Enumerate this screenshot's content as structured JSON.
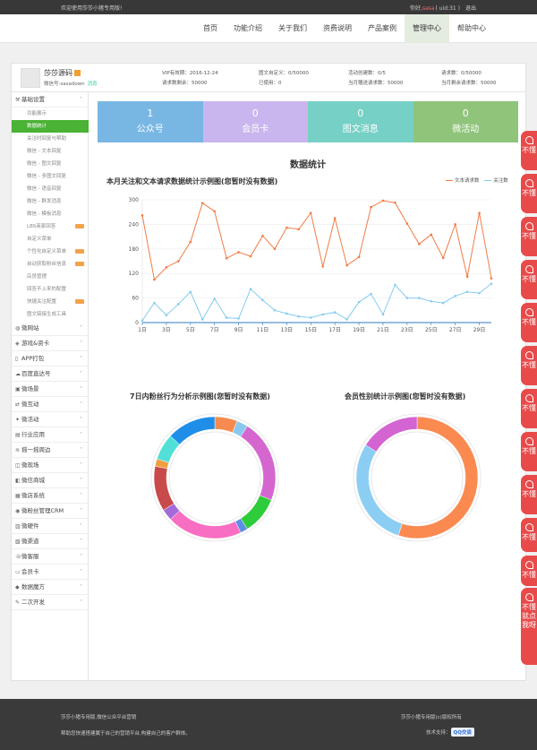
{
  "topbar": {
    "welcome": "欢迎使用莎莎小猪专用版!",
    "hello": "你好,",
    "user": "sasa",
    "uid": "( uid:31 )",
    "logout": "退出"
  },
  "nav": [
    "首页",
    "功能介绍",
    "关于我们",
    "资费说明",
    "产品案例",
    "管理中心",
    "帮助中心"
  ],
  "user": {
    "name": "莎莎源码",
    "account": "微信号:sasadown",
    "message": "消息"
  },
  "stats": {
    "vip": "VIP有效期：2016-12-24",
    "req_left": "请求数剩余：50000",
    "custom": "图文自定义：0/50000",
    "used": "已使用：0",
    "activity": "活动创建数：0/5",
    "month_req": "当月赠送请求数：50000",
    "req": "请求数：0/50000",
    "month_left": "当月剩余请求数：50000"
  },
  "sidebar": {
    "groups": [
      {
        "icon": "tools-icon",
        "label": "基础设置",
        "subs": [
          "功能展示",
          "数据统计",
          "关注时回复与帮助",
          "微信 - 文本回复",
          "微信 - 图文回复",
          "微信 - 多图文回复",
          "微信 - 语音回复",
          "微信 - 群发消息",
          "微信 - 模板消息",
          "LBS商家回答",
          "自定义菜单",
          "个性化自定义菜单",
          "自动获取粉丝信息",
          "店员管理",
          "回答不上来的配置",
          "快捷关注配置",
          "图文链接生成工具"
        ]
      },
      {
        "icon": "globe-icon",
        "label": "微网站"
      },
      {
        "icon": "gamepad-icon",
        "label": "游戏&资卡"
      },
      {
        "icon": "phone-icon",
        "label": "APP打包"
      },
      {
        "icon": "cloud-icon",
        "label": "百度直达号"
      },
      {
        "icon": "scene-icon",
        "label": "微场景"
      },
      {
        "icon": "interact-icon",
        "label": "微互动"
      },
      {
        "icon": "activity-icon",
        "label": "微活动"
      },
      {
        "icon": "industry-icon",
        "label": "行业应用"
      },
      {
        "icon": "shake-icon",
        "label": "摇一摇周边"
      },
      {
        "icon": "stage-icon",
        "label": "微现场"
      },
      {
        "icon": "shop-icon",
        "label": "微信商城"
      },
      {
        "icon": "system-icon",
        "label": "微店系统"
      },
      {
        "icon": "crm-icon",
        "label": "微粉丝管理CRM"
      },
      {
        "icon": "hardware-icon",
        "label": "微硬件"
      },
      {
        "icon": "channel-icon",
        "label": "微渠道"
      },
      {
        "icon": "service-icon",
        "label": "微客服"
      },
      {
        "icon": "card-icon",
        "label": "会员卡"
      },
      {
        "icon": "magic-icon",
        "label": "数据魔方"
      },
      {
        "icon": "wrench-icon",
        "label": "二次开发"
      }
    ],
    "active_sub": "数据统计",
    "hot_subs": [
      "LBS商家回答",
      "个性化自定义菜单",
      "自动获取粉丝信息",
      "快捷关注配置"
    ]
  },
  "tiles": [
    {
      "num": "1",
      "label": "公众号",
      "color": "#78b7e4"
    },
    {
      "num": "0",
      "label": "会员卡",
      "color": "#c9b6ee"
    },
    {
      "num": "0",
      "label": "图文消息",
      "color": "#76d0c5"
    },
    {
      "num": "0",
      "label": "微活动",
      "color": "#8fc47a"
    }
  ],
  "section_title": "数据统计",
  "chart_data": [
    {
      "type": "line",
      "title": "本月关注和文本请求数据统计示例图(您暂时没有数据)",
      "x": [
        "1日",
        "2日",
        "3日",
        "4日",
        "5日",
        "6日",
        "7日",
        "8日",
        "9日",
        "10日",
        "11日",
        "12日",
        "13日",
        "14日",
        "15日",
        "16日",
        "17日",
        "18日",
        "19日",
        "20日",
        "21日",
        "22日",
        "23日",
        "24日",
        "25日",
        "26日",
        "27日",
        "28日",
        "29日",
        "30日"
      ],
      "x_tick_labels": [
        "1日",
        "3日",
        "5日",
        "7日",
        "9日",
        "11日",
        "13日",
        "15日",
        "17日",
        "19日",
        "21日",
        "23日",
        "25日",
        "27日",
        "29日"
      ],
      "ylim": [
        0,
        300
      ],
      "yticks": [
        "0",
        "60",
        "120",
        "180",
        "240",
        "300"
      ],
      "legend": "top-right",
      "series": [
        {
          "name": "文本请求数",
          "color": "#f07c45",
          "values": [
            262,
            105,
            135,
            150,
            197,
            292,
            272,
            157,
            172,
            162,
            212,
            180,
            232,
            228,
            268,
            137,
            255,
            140,
            160,
            282,
            298,
            293,
            242,
            192,
            215,
            158,
            240,
            112,
            268,
            108
          ]
        },
        {
          "name": "关注数",
          "color": "#86ccee",
          "values": [
            5,
            48,
            18,
            45,
            75,
            8,
            58,
            12,
            10,
            82,
            55,
            30,
            22,
            15,
            12,
            20,
            25,
            8,
            50,
            70,
            20,
            92,
            60,
            60,
            52,
            48,
            65,
            75,
            72,
            95
          ]
        }
      ]
    },
    {
      "type": "pie",
      "title": "7日内粉丝行为分析示例图(您暂时没有数据)",
      "labels": [],
      "values": [
        6,
        3,
        22,
        10,
        2,
        20,
        3,
        12,
        2,
        7,
        13
      ],
      "colors": [
        "#f78a50",
        "#8ac8f0",
        "#d566d0",
        "#2ecc3a",
        "#5c8ee4",
        "#f76ec2",
        "#a36ad8",
        "#c84a4a",
        "#f0a040",
        "#50e0d8",
        "#1f8ee8"
      ]
    },
    {
      "type": "pie",
      "title": "会员性别统计示例图(您暂时没有数据)",
      "labels": [],
      "values": [
        55,
        29,
        16
      ],
      "colors": [
        "#fb8a50",
        "#8ccef3",
        "#d464d2"
      ]
    }
  ],
  "side_tabs": [
    "不懂",
    "不懂",
    "不懂",
    "不懂",
    "不懂",
    "不懂",
    "不懂",
    "不懂",
    "不懂",
    "不懂",
    "不懂",
    "不懂就点我呀"
  ],
  "footer": {
    "left1": "莎莎小猪专用版,微信公众平台营销",
    "left2": "帮助您快速搭建属于自己的营销平台,构建自己的客户群体。",
    "right1": "莎莎小猪专用版(c)版权所有",
    "right2": "技术支持：",
    "qq": "QQ交谈"
  }
}
